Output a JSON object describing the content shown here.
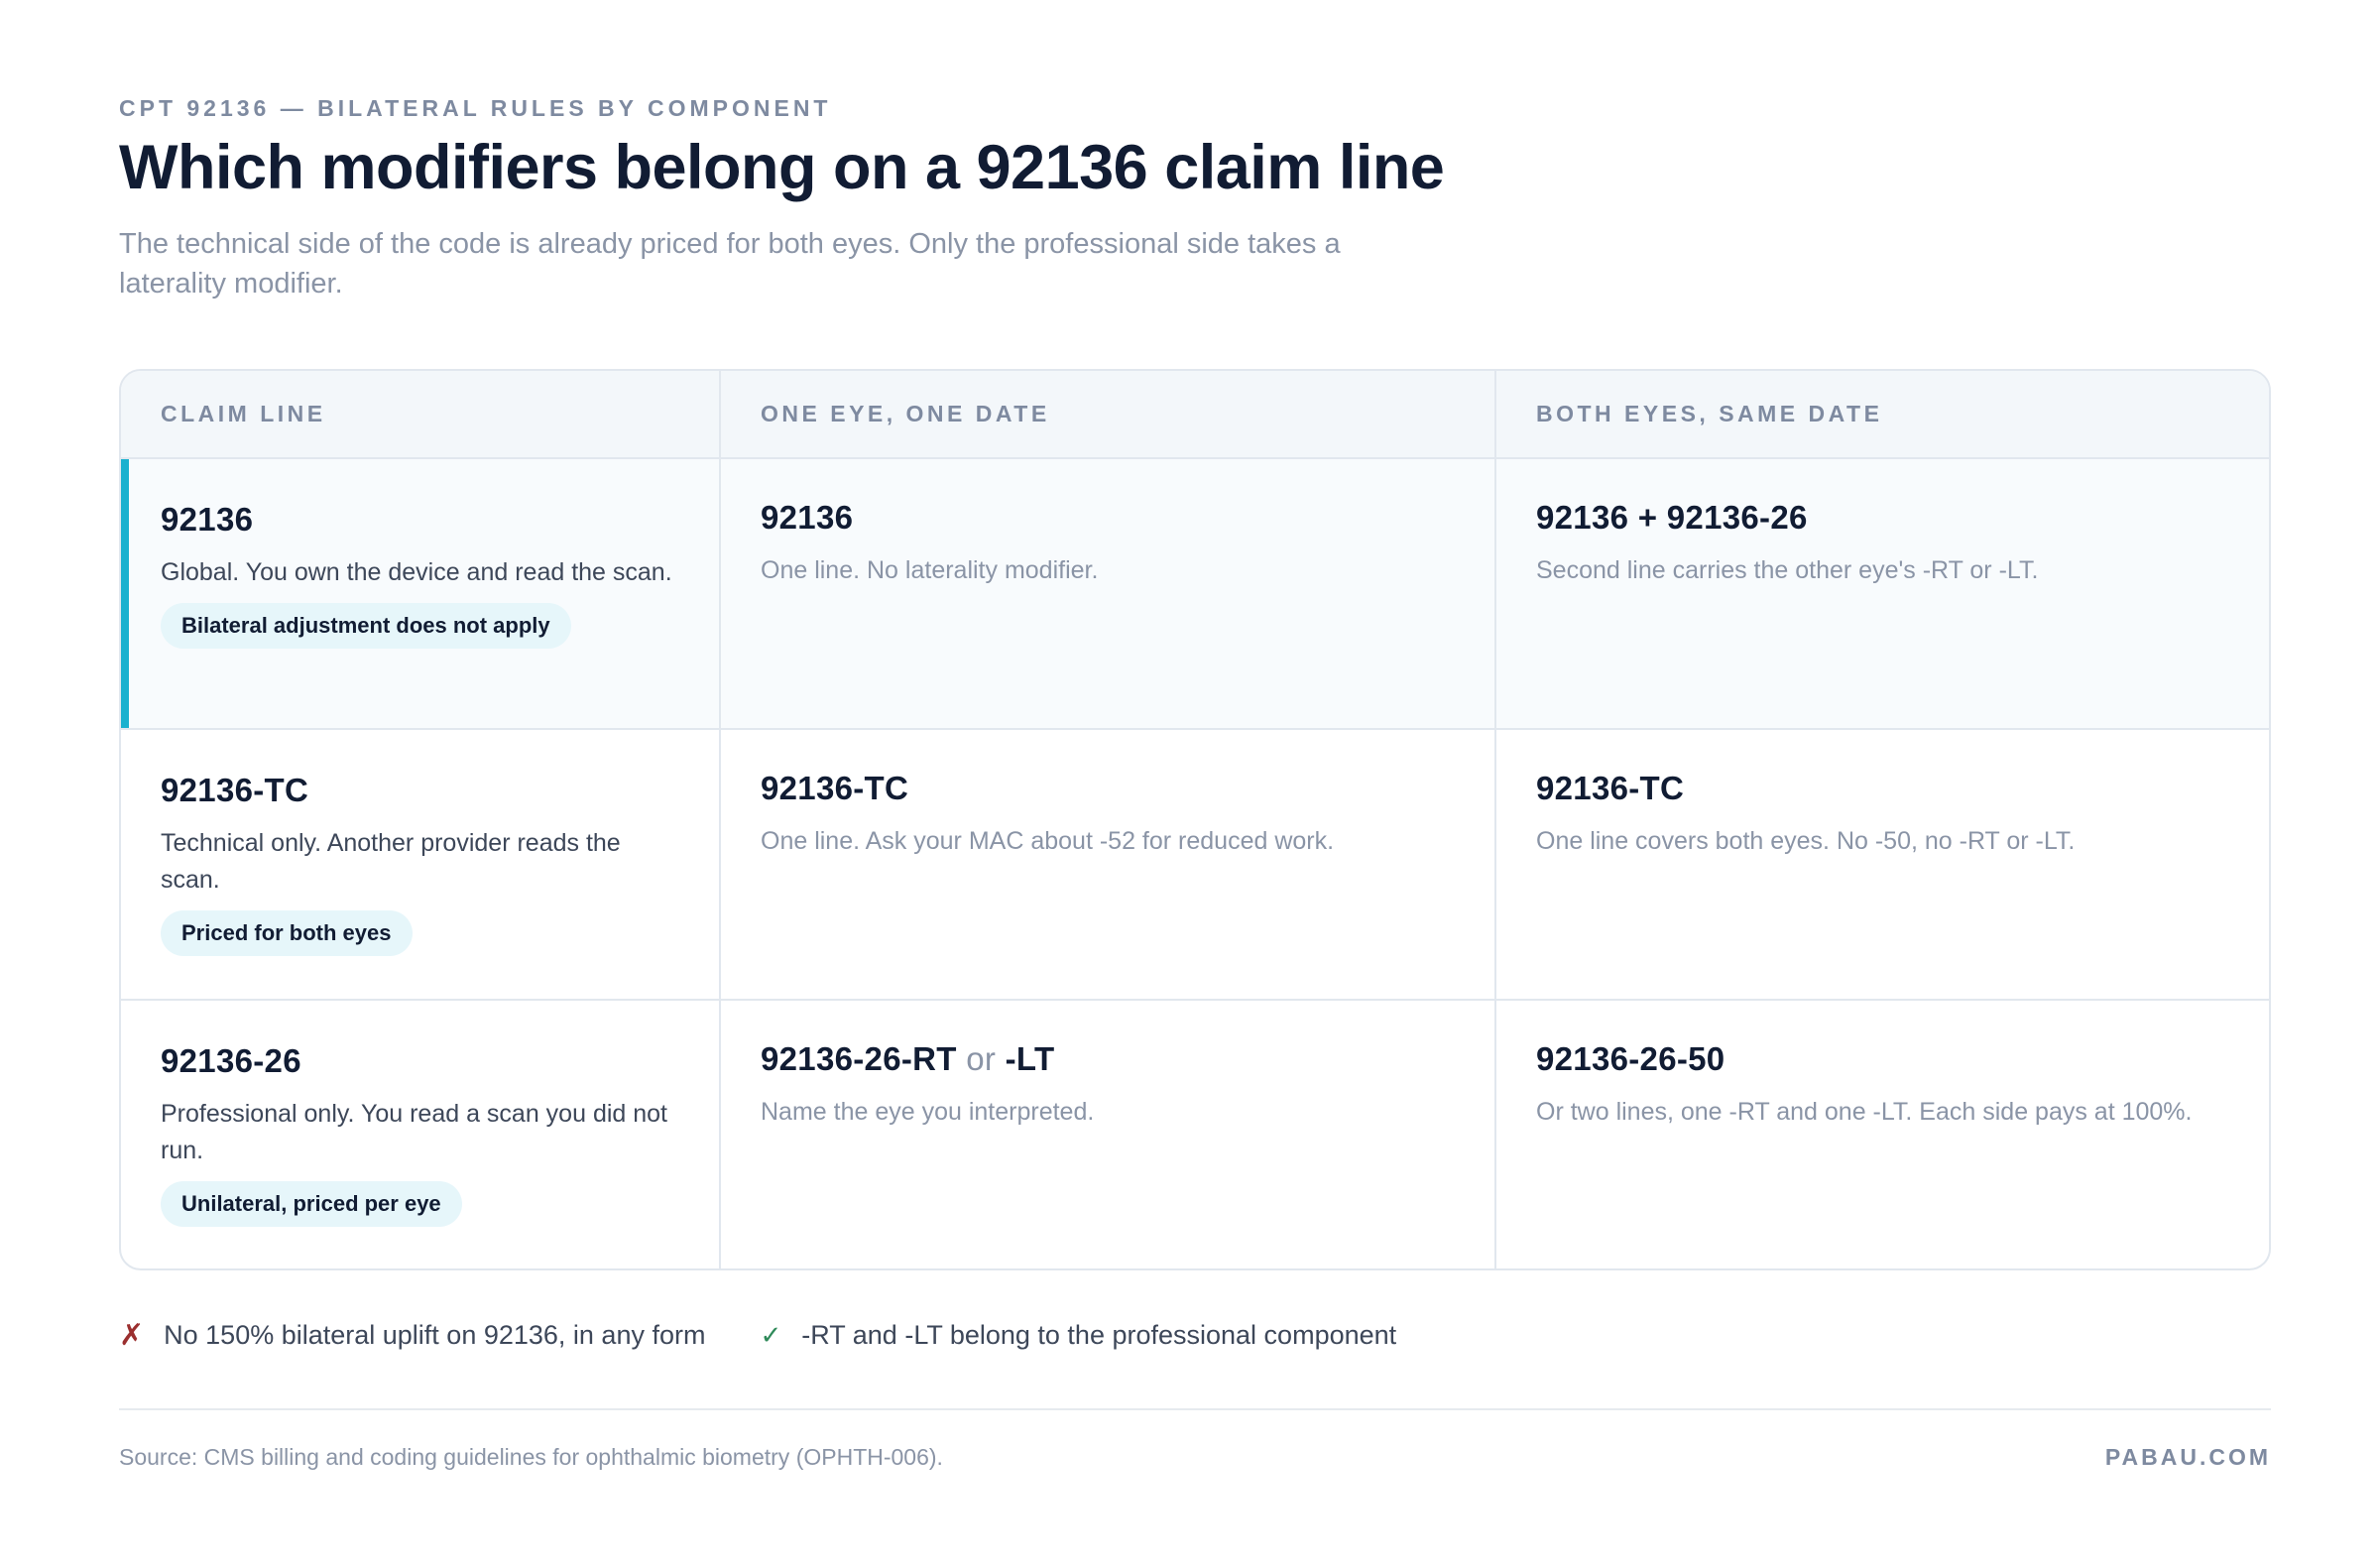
{
  "header": {
    "eyebrow": "CPT 92136 — BILATERAL RULES BY COMPONENT",
    "title": "Which modifiers belong on a 92136 claim line",
    "subtitle": "The technical side of the code is already priced for both eyes. Only the professional side takes a laterality modifier."
  },
  "table": {
    "columns": [
      "CLAIM LINE",
      "ONE EYE, ONE DATE",
      "BOTH EYES, SAME DATE"
    ],
    "rows": [
      {
        "code": "92136",
        "description": "Global. You own the device and read the scan.",
        "badge": "Bilateral adjustment does not apply",
        "one_eye_code": "92136",
        "one_eye_note": "One line. No laterality modifier.",
        "both_eyes_code": "92136 + 92136-26",
        "both_eyes_note": "Second line carries the other eye's -RT or -LT."
      },
      {
        "code": "92136-TC",
        "description": "Technical only. Another provider reads the scan.",
        "badge": "Priced for both eyes",
        "one_eye_code": "92136-TC",
        "one_eye_note": "One line. Ask your MAC about -52 for reduced work.",
        "both_eyes_code": "92136-TC",
        "both_eyes_note": "One line covers both eyes. No -50, no -RT or -LT."
      },
      {
        "code": "92136-26",
        "description": "Professional only. You read a scan you did not run.",
        "badge": "Unilateral, priced per eye",
        "one_eye_code_a": "92136-26-RT",
        "one_eye_code_or": "or",
        "one_eye_code_b": "-LT",
        "one_eye_note": "Name the eye you interpreted.",
        "both_eyes_code": "92136-26-50",
        "both_eyes_note": "Or two lines, one -RT and one -LT. Each side pays at 100%."
      }
    ]
  },
  "footnotes": [
    {
      "icon": "cross-icon",
      "symbol": "✗",
      "text": "No 150% bilateral uplift on 92136, in any form"
    },
    {
      "icon": "check-icon",
      "symbol": "✓",
      "text": "-RT and -LT belong to the professional component"
    }
  ],
  "footer": {
    "source": "Source: CMS billing and coding guidelines for ophthalmic biometry (OPHTH-006).",
    "brand": "PABAU.COM"
  },
  "colors": {
    "accent": "#1ab1cf",
    "badge_bg": "#e6f6fa",
    "cross": "#9b2f2f",
    "check": "#2f8a5a",
    "title": "#111c33",
    "muted": "#8a94a6"
  }
}
